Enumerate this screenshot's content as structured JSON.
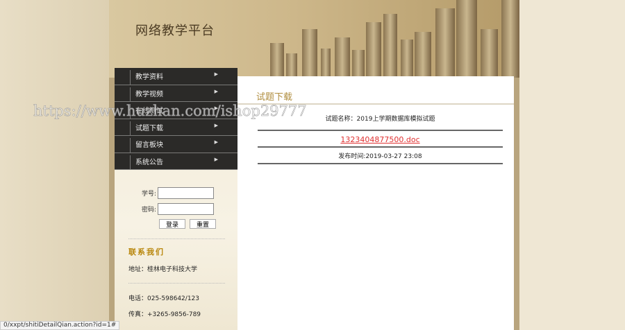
{
  "header": {
    "title": "网络教学平台"
  },
  "menu": [
    {
      "label": "教学资料"
    },
    {
      "label": "教学视频"
    },
    {
      "label": "在线测试"
    },
    {
      "label": "试题下载"
    },
    {
      "label": "留言板块"
    },
    {
      "label": "系统公告"
    }
  ],
  "login": {
    "id_label": "学号:",
    "pwd_label": "密码:",
    "login_btn": "登录",
    "reset_btn": "重置"
  },
  "contact": {
    "title": "联系我们",
    "address": "地址：桂林电子科技大学",
    "phone": "电话：025-598642/123",
    "fax": "传真：+3265-9856-789"
  },
  "content": {
    "title": "试题下载",
    "name": "试题名称：2019上学期数据库模拟试题",
    "file": "1323404877500.doc",
    "time": "发布时间:2019-03-27 23:08"
  },
  "status_url": "0/xxpt/shitiDetailQian.action?id=1#",
  "watermark": "https://www.huzhan.com/ishop29777"
}
